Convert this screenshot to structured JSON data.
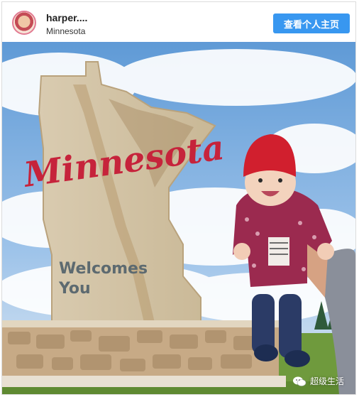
{
  "post": {
    "username": "harper....",
    "location": "Minnesota",
    "view_profile_label": "查看个人主页"
  },
  "sign": {
    "script_text": "Minnesota",
    "line1": "Welcomes",
    "line2": "You"
  },
  "watermark": {
    "text": "超级生活",
    "icon": "wechat-icon"
  },
  "colors": {
    "button": "#3897f0",
    "sky": "#6fa7dc",
    "script_red": "#c6233b",
    "hat_red": "#d11f2e",
    "jacket": "#9b2a4f"
  }
}
